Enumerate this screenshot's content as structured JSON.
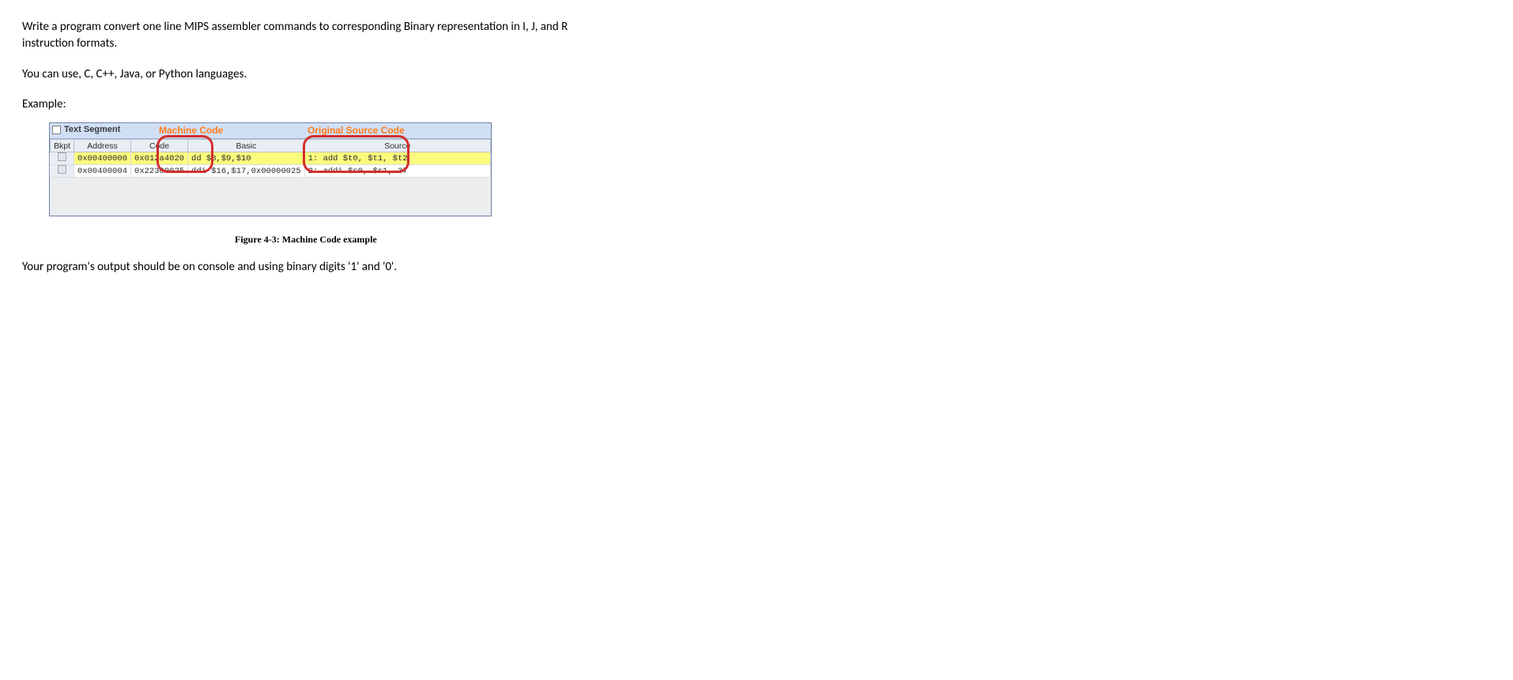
{
  "para1": "Write a program convert one line MIPS assembler commands to corresponding Binary representation in I, J, and R instruction formats.",
  "para2": "You can use, C, C++, Java, or Python languages.",
  "example_label": "Example:",
  "panel": {
    "title": "Text Segment",
    "label_machine": "Machine Code",
    "label_source": "Original Source Code",
    "headers": {
      "bkpt": "Bkpt",
      "address": "Address",
      "code": "Code",
      "basic": "Basic",
      "source": "Source"
    },
    "rows": [
      {
        "address": "0x00400000",
        "code": "0x012a4020",
        "basic": "dd $8,$9,$10",
        "source": "1: add $t0, $t1, $t2"
      },
      {
        "address": "0x00400004",
        "code": "0x22300025",
        "basic": "ddi $16,$17,0x00000025",
        "source": "2: addi $s0, $s1, 37"
      }
    ]
  },
  "figure_caption": "Figure 4-3: Machine Code example",
  "output_note": "Your program's output should be on console and using binary digits '1' and '0'."
}
